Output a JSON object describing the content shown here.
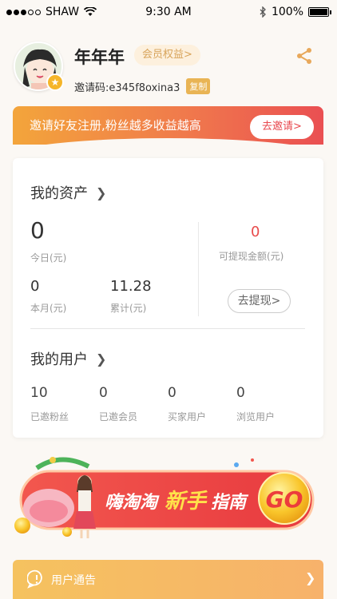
{
  "status": {
    "carrier": "SHAW",
    "time": "9:30 AM",
    "battery": "100%",
    "signal_bars": 3,
    "signal_total": 5
  },
  "profile": {
    "username": "年年年",
    "member_label": "会员权益>",
    "invite_code": "邀请码:e345f8oxina3",
    "copy_label": "复制"
  },
  "invite_banner": {
    "text": "邀请好友注册,粉丝越多收益越高",
    "button": "去邀请>"
  },
  "assets": {
    "title": "我的资产",
    "today_value": "0",
    "today_label": "今日(元)",
    "withdrawable_value": "0",
    "withdrawable_label": "可提现金额(元)",
    "month_value": "0",
    "month_label": "本月(元)",
    "total_value": "11.28",
    "total_label": "累计(元)",
    "withdraw_button": "去提现>"
  },
  "users": {
    "title": "我的用户",
    "stats": [
      {
        "value": "10",
        "label": "已邀粉丝"
      },
      {
        "value": "0",
        "label": "已邀会员"
      },
      {
        "value": "0",
        "label": "买家用户"
      },
      {
        "value": "0",
        "label": "浏览用户"
      }
    ]
  },
  "guide_banner": {
    "text_a": "嗨淘淘",
    "text_b": "新手",
    "text_c": "指南",
    "go": "GO"
  },
  "notice": {
    "text": "用户通告"
  },
  "colors": {
    "accent_red": "#e84b4b",
    "gold": "#e9b454",
    "banner_orange": "#f3a53b"
  }
}
